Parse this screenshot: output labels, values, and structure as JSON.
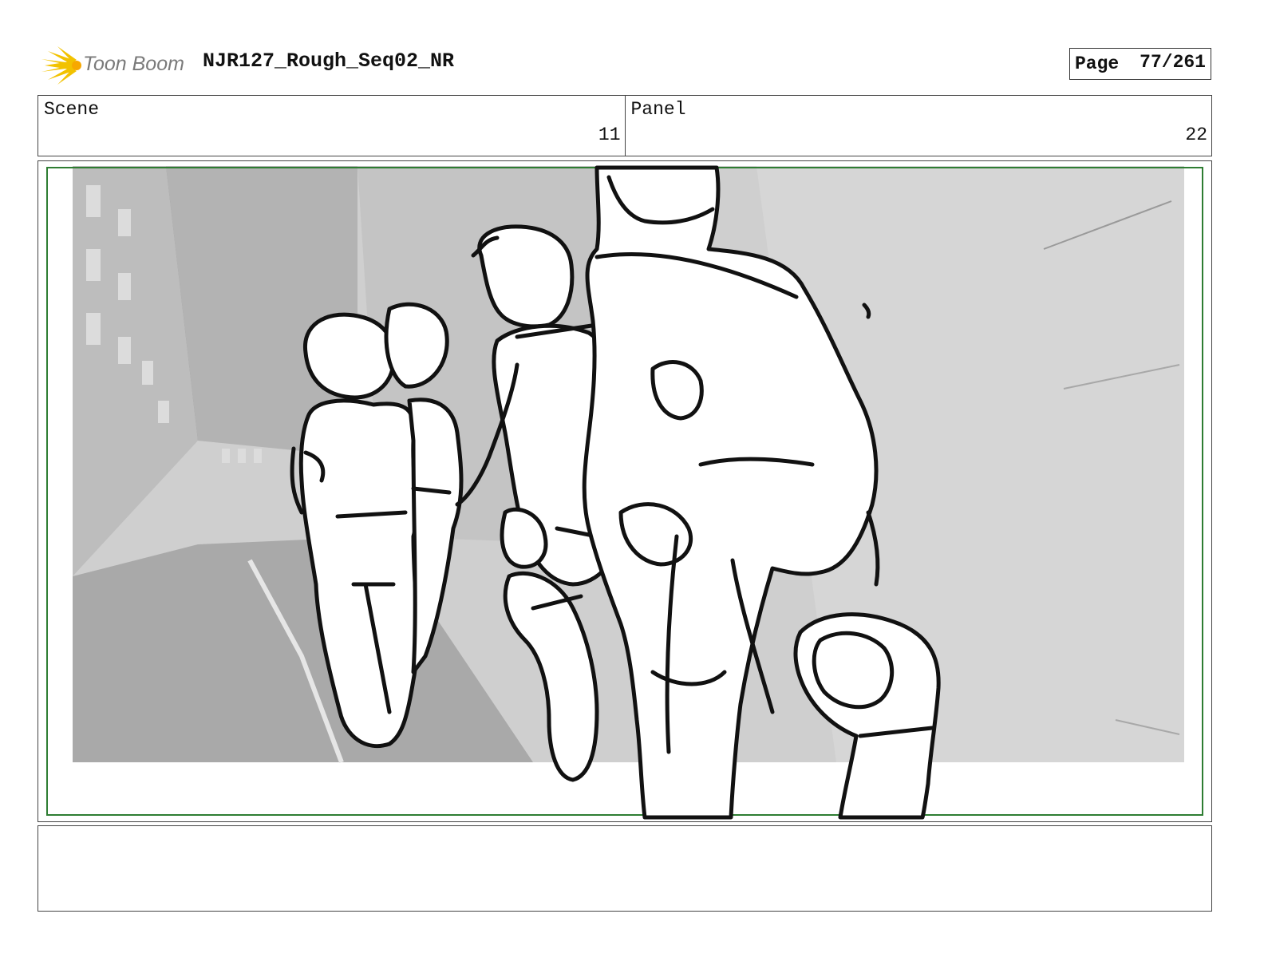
{
  "header": {
    "brand": "Toon Boom",
    "doc_title": "NJR127_Rough_Seq02_NR",
    "page_label": "Page",
    "page_number": "77/261"
  },
  "info": {
    "scene_label": "Scene",
    "scene_value": "11",
    "panel_label": "Panel",
    "panel_value": "22"
  },
  "colors": {
    "safe_frame": "#2e7d32",
    "background_render": "#c9c9c9",
    "logo_flare": "#f2c200"
  },
  "notes": {
    "text": ""
  }
}
